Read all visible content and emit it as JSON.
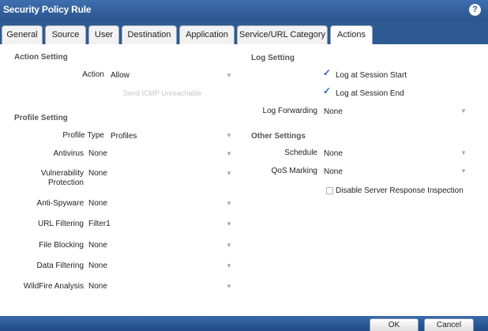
{
  "dialog": {
    "title": "Security Policy Rule",
    "help_icon": "?"
  },
  "tabs": [
    "General",
    "Source",
    "User",
    "Destination",
    "Application",
    "Service/URL Category",
    "Actions"
  ],
  "active_tab": "Actions",
  "action_setting": {
    "title": "Action Setting",
    "action_label": "Action",
    "action_value": "Allow",
    "faded_text": "Send ICMP Unreachable"
  },
  "profile_setting": {
    "title": "Profile Setting",
    "rows": [
      {
        "label": "Profile Type",
        "value": "Profiles"
      },
      {
        "label": "Antivirus",
        "value": "None"
      },
      {
        "label": "Vulnerability Protection",
        "value": "None"
      },
      {
        "label": "Anti-Spyware",
        "value": "None"
      },
      {
        "label": "URL Filtering",
        "value": "Filter1"
      },
      {
        "label": "File Blocking",
        "value": "None"
      },
      {
        "label": "Data Filtering",
        "value": "None"
      },
      {
        "label": "WildFire Analysis",
        "value": "None"
      }
    ]
  },
  "log_setting": {
    "title": "Log Setting",
    "log_session_start": "Log at Session Start",
    "log_session_end": "Log at Session End",
    "log_forwarding_label": "Log Forwarding",
    "log_forwarding_value": "None"
  },
  "other_settings": {
    "title": "Other Settings",
    "schedule_label": "Schedule",
    "schedule_value": "None",
    "qos_label": "QoS Marking",
    "qos_value": "None",
    "disable_srv_label": "Disable Server Response Inspection"
  },
  "buttons": {
    "ok": "OK",
    "cancel": "Cancel"
  },
  "icons": {
    "checkmark": "✓",
    "dropdown": "▼"
  }
}
